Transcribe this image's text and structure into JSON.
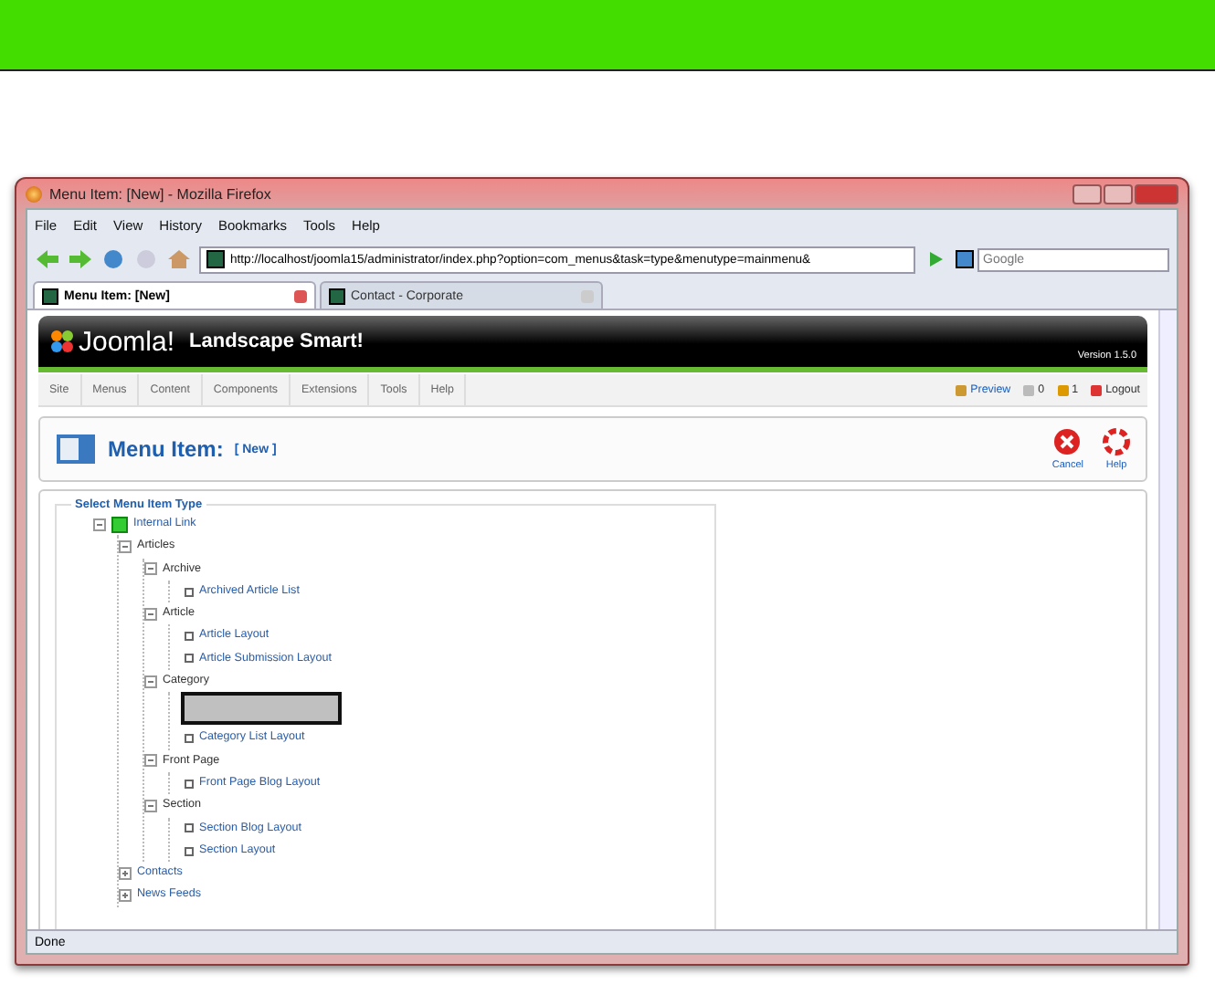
{
  "window": {
    "title": "Menu Item: [New] - Mozilla Firefox"
  },
  "menu": [
    "File",
    "Edit",
    "View",
    "History",
    "Bookmarks",
    "Tools",
    "Help"
  ],
  "address": {
    "url": "http://localhost/joomla15/administrator/index.php?option=com_menus&task=type&menutype=mainmenu&",
    "search_placeholder": "Google"
  },
  "tabs": [
    {
      "label": "Menu Item: [New]",
      "selected": true
    },
    {
      "label": "Contact - Corporate",
      "selected": false
    }
  ],
  "joomla": {
    "logo": "Joomla!",
    "site_name": "Landscape Smart!",
    "version": "Version 1.5.0",
    "menu": [
      "Site",
      "Menus",
      "Content",
      "Components",
      "Extensions",
      "Tools",
      "Help"
    ],
    "status": [
      {
        "kind": "preview",
        "label": "Preview"
      },
      {
        "kind": "messages",
        "label": "0"
      },
      {
        "kind": "users",
        "label": "1"
      },
      {
        "kind": "logout",
        "label": "Logout"
      }
    ]
  },
  "toolbar": {
    "title": "Menu Item:",
    "subtitle": "[ New ]",
    "buttons": [
      {
        "kind": "cancel",
        "label": "Cancel"
      },
      {
        "kind": "help",
        "label": "Help"
      }
    ]
  },
  "fieldset": {
    "legend": "Select Menu Item Type",
    "tree": [
      {
        "kind": "root",
        "label": "Internal Link",
        "expanded": true,
        "children": [
          {
            "kind": "group",
            "label": "Articles",
            "expanded": true,
            "children": [
              {
                "kind": "group",
                "label": "Archive",
                "expanded": true,
                "children": [
                  {
                    "kind": "leaf",
                    "label": "Archived Article List"
                  }
                ]
              },
              {
                "kind": "group",
                "label": "Article",
                "expanded": true,
                "children": [
                  {
                    "kind": "leaf",
                    "label": "Article Layout"
                  },
                  {
                    "kind": "leaf",
                    "label": "Article Submission Layout"
                  }
                ]
              },
              {
                "kind": "group",
                "label": "Category",
                "expanded": true,
                "children": [
                  {
                    "kind": "redacted"
                  },
                  {
                    "kind": "leaf",
                    "label": "Category List Layout"
                  }
                ]
              },
              {
                "kind": "group",
                "label": "Front Page",
                "expanded": true,
                "children": [
                  {
                    "kind": "leaf",
                    "label": "Front Page Blog Layout"
                  }
                ]
              },
              {
                "kind": "group",
                "label": "Section",
                "expanded": true,
                "children": [
                  {
                    "kind": "leaf",
                    "label": "Section Blog Layout"
                  },
                  {
                    "kind": "leaf",
                    "label": "Section Layout"
                  }
                ]
              }
            ]
          },
          {
            "kind": "link-group",
            "label": "Contacts",
            "expanded": false
          },
          {
            "kind": "link-group",
            "label": "News Feeds",
            "expanded": false
          }
        ]
      }
    ]
  },
  "status_bar": "Done"
}
